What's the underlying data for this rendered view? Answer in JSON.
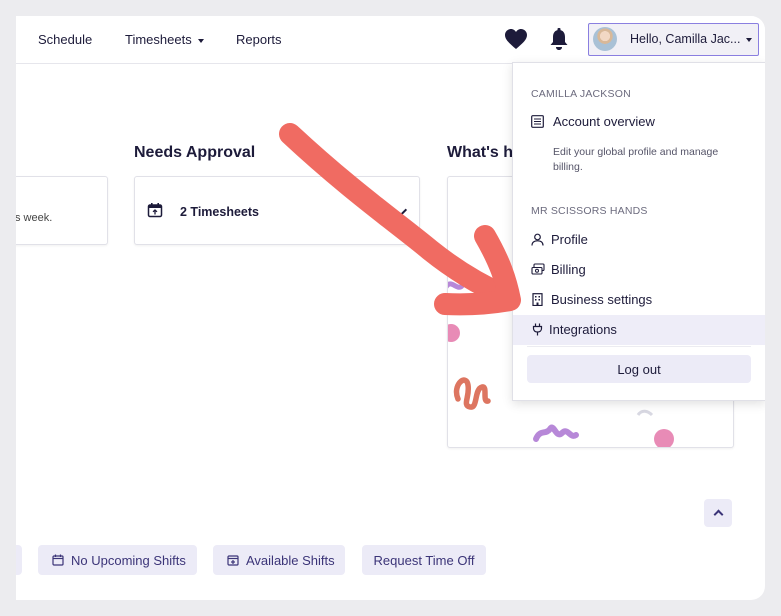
{
  "nav": {
    "schedule": "Schedule",
    "timesheets": "Timesheets",
    "reports": "Reports"
  },
  "user_menu": {
    "greeting": "Hello, Camilla Jac..."
  },
  "sections": {
    "left_card_text": "s week.",
    "needs_approval_title": "Needs Approval",
    "timesheets_count": "2 Timesheets",
    "whats_title": "What's h"
  },
  "dropdown": {
    "user_heading": "CAMILLA JACKSON",
    "account_overview": "Account overview",
    "account_overview_desc": "Edit your global profile and manage billing.",
    "business_heading": "MR SCISSORS HANDS",
    "profile": "Profile",
    "billing": "Billing",
    "business_settings": "Business settings",
    "integrations": "Integrations",
    "logout": "Log out"
  },
  "bottom_bar": {
    "no_upcoming": "No Upcoming Shifts",
    "available": "Available Shifts",
    "request_time_off": "Request Time Off"
  },
  "colors": {
    "accent": "#3b3478",
    "pill_bg": "#ecebf7",
    "arrow": "#f06b62",
    "active_item": "#eeedf8"
  }
}
